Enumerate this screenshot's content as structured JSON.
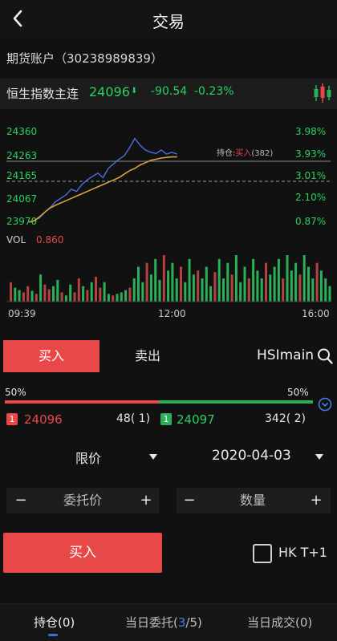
{
  "header": {
    "title": "交易",
    "back_icon": "chevron-left-icon"
  },
  "account": {
    "label": "期货账户（30238989839）"
  },
  "quote": {
    "name": "恒生指数主连",
    "price": "24096",
    "arrow": "⬇",
    "change": "-90.54",
    "pct": "-0.23%",
    "chart_icon": "candlestick-icon"
  },
  "chart": {
    "y_left": [
      "24360",
      "24263",
      "24165",
      "24067",
      "23970"
    ],
    "y_right": [
      "3.98%",
      "3.93%",
      "3.01%",
      "2.10%",
      "0.87%"
    ],
    "position_label": "持仓:",
    "position_side": "买入",
    "position_qty": "(382)",
    "vol_label": "VOL",
    "vol_value": "0.860",
    "x_labels": [
      "09:39",
      "12:00",
      "16:00"
    ]
  },
  "chart_data": {
    "type": "line",
    "series": [
      {
        "values": [
          23965,
          23975,
          23985,
          24010,
          24030,
          24055,
          24070,
          24085,
          24110,
          24100,
          24130,
          24150,
          24165,
          24180,
          24160,
          24200,
          24220,
          24240,
          24255,
          24290,
          24330,
          24300,
          24280,
          24270,
          24265,
          24280,
          24262,
          24270,
          24262
        ]
      },
      {
        "values": [
          23968,
          23972,
          23990,
          24010,
          24028,
          24040,
          24050,
          24060,
          24070,
          24080,
          24090,
          24100,
          24110,
          24120,
          24130,
          24140,
          24150,
          24160,
          24175,
          24190,
          24200,
          24215,
          24225,
          24235,
          24240,
          24245,
          24248,
          24250,
          24250
        ]
      }
    ],
    "volume": [
      0.25,
      0.18,
      0.15,
      0.12,
      0.2,
      0.14,
      0.1,
      0.35,
      0.22,
      0.16,
      0.2,
      0.28,
      0.12,
      0.08,
      0.22,
      0.12,
      0.3,
      0.2,
      0.15,
      0.25,
      0.32,
      0.18,
      0.25,
      0.1,
      0.08,
      0.1,
      0.12,
      0.15,
      0.18,
      0.3,
      0.45,
      0.25,
      0.5,
      0.35,
      0.55,
      0.28,
      0.6,
      0.4,
      0.5,
      0.3,
      0.45,
      0.25,
      0.55,
      0.35,
      0.4,
      0.3,
      0.45,
      0.2,
      0.38,
      0.55,
      0.3,
      0.5,
      0.35,
      0.6,
      0.25,
      0.45,
      0.3,
      0.55,
      0.4,
      0.3,
      0.5,
      0.35,
      0.45,
      0.55,
      0.3,
      0.6,
      0.4,
      0.5,
      0.35,
      0.6,
      0.45,
      0.3,
      0.5,
      0.4,
      0.3,
      0.2
    ],
    "ylim": [
      23970,
      24360
    ],
    "grid": false,
    "colors": {
      "price": "#4a6fe0",
      "avg": "#d7a33a",
      "vol_up": "#2bb05a",
      "vol_down": "#b54242"
    }
  },
  "trade": {
    "tab_buy": "买入",
    "tab_sell": "卖出",
    "symbol": "HSImain",
    "search_icon": "search-icon",
    "pct_left": "50%",
    "pct_right": "50%",
    "bid_level": "1",
    "bid_price": "24096",
    "bid_qty": "48(   1)",
    "ask_level": "1",
    "ask_price": "24097",
    "ask_qty": "342(   2)",
    "order_type": "限价",
    "date": "2020-04-03",
    "price_placeholder": "委托价",
    "qty_placeholder": "数量",
    "minus": "−",
    "plus": "+",
    "submit": "买入",
    "hk_label": "HK T+1"
  },
  "bottom": {
    "tab1": "持仓(0)",
    "tab2_prefix": "当日委托(",
    "tab2_num": "3",
    "tab2_suffix": "/5)",
    "tab3": "当日成交(0)"
  },
  "colors": {
    "red": "#e84848",
    "green": "#2bd05f",
    "accent_blue": "#3d6dd8"
  }
}
